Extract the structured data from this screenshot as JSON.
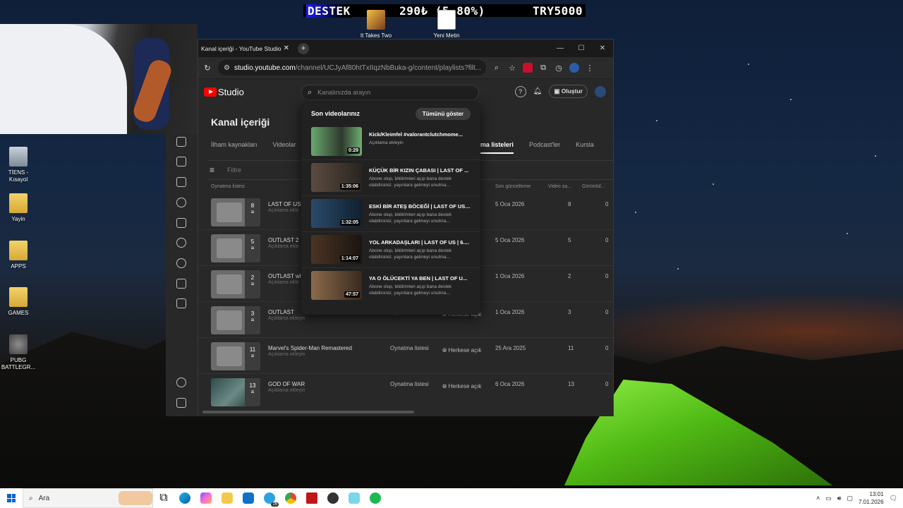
{
  "overlay": {
    "destek": "DESTEK",
    "amount": "290₺ (5.80%)",
    "goal": "TRY5000"
  },
  "desktop": {
    "icons": [
      {
        "label": "TİENS - Kısayol"
      },
      {
        "label": "Yayin"
      },
      {
        "label": "APPS"
      },
      {
        "label": "GAMES"
      },
      {
        "label": "PUBG BATTLEGR..."
      }
    ],
    "top_icons": [
      {
        "label": "It Takes Two"
      },
      {
        "label": "Yeni Metin Belgesi (2)"
      }
    ]
  },
  "browser": {
    "tab_title": "Kanal içeriği - YouTube Studio",
    "url_host": "studio.youtube.com",
    "url_path": "/channel/UCJyAf80htTxIIqzNbBuka-g/content/playlists?filt..."
  },
  "studio": {
    "logo_text": "Studio",
    "search_placeholder": "Kanalınızda arayın",
    "create_label": "Oluştur",
    "page_title": "Kanal içeriği",
    "tabs": [
      "İlham kaynakları",
      "Videolar",
      "Oynatma listeleri",
      "Podcast'ler",
      "Kursla"
    ],
    "filter_placeholder": "Filtre",
    "columns": {
      "playlist": "Oynatma listesi",
      "last_updated": "Son güncelleme",
      "video_count": "Video sa...",
      "views": "Görüntül..."
    },
    "playlists": [
      {
        "count": "8",
        "title": "LAST OF US",
        "desc": "Açıklama ekle",
        "type": "",
        "vis": "",
        "date": "5 Oca 2026",
        "videos": "8",
        "views": "0"
      },
      {
        "count": "5",
        "title": "OUTLAST 2",
        "desc": "Açıklama ekle",
        "type": "",
        "vis": "",
        "date": "5 Oca 2026",
        "videos": "5",
        "views": "0"
      },
      {
        "count": "2",
        "title": "OUTLAST whi",
        "desc": "Açıklama ekle",
        "type": "",
        "vis": "",
        "date": "1 Oca 2026",
        "videos": "2",
        "views": "0"
      },
      {
        "count": "3",
        "title": "OUTLAST",
        "desc": "Açıklama ekleyin",
        "type": "Oynatma listesi",
        "vis": "Herkese açık",
        "date": "1 Oca 2026",
        "videos": "3",
        "views": "0"
      },
      {
        "count": "11",
        "title": "Marvel's Spider-Man Remastered",
        "desc": "Açıklama ekleyin",
        "type": "Oynatma listesi",
        "vis": "Herkese açık",
        "date": "25 Ara 2025",
        "videos": "11",
        "views": "0"
      },
      {
        "count": "13",
        "title": "GOD OF WAR",
        "desc": "Açıklama ekleyin",
        "type": "Oynatma listesi",
        "vis": "Herkese açık",
        "date": "6 Oca 2026",
        "videos": "13",
        "views": "0"
      }
    ],
    "dropdown": {
      "heading": "Son videolarınız",
      "show_all": "Tümünü göster",
      "videos": [
        {
          "title": "Kick/Kleimfel #valorantclutchmome...",
          "desc": "Açıklama ekleyin",
          "duration": "0:29",
          "color": "#4f8a5a"
        },
        {
          "title": "KÜÇÜK BİR KIZIN ÇABASI | LAST OF ...",
          "desc": "Abone olup, bildirimleri açıp bana destek olabilirsiniz. yayınlara gelmeyi unutma...",
          "duration": "1:35:06",
          "color": "#4a3d35"
        },
        {
          "title": "ESKİ BİR ATEŞ BÖCEĞİ | LAST OF US ...",
          "desc": "Abone olup, bildirimleri açıp bana destek olabilirsiniz. yayınlara gelmeyi unutma...",
          "duration": "1:32:05",
          "color": "#1f3b5a"
        },
        {
          "title": "YOL ARKADAŞLARI | LAST OF US | 6....",
          "desc": "Abone olup, bildirimleri açıp bana destek olabilirsiniz. yayınlara gelmeyi unutma...",
          "duration": "1:14:07",
          "color": "#3b2b1e"
        },
        {
          "title": "YA O ÖLÜCEKTİ YA BEN | LAST OF U...",
          "desc": "Abone olup, bildirimleri açıp bana destek olabilirsiniz. yayınlara gelmeyi unutma...",
          "duration": "47:57",
          "color": "#6b4a32"
        }
      ]
    }
  },
  "taskbar": {
    "search_label": "Ara",
    "time": "13:01",
    "date": "7.01.2026",
    "badge": "16"
  }
}
